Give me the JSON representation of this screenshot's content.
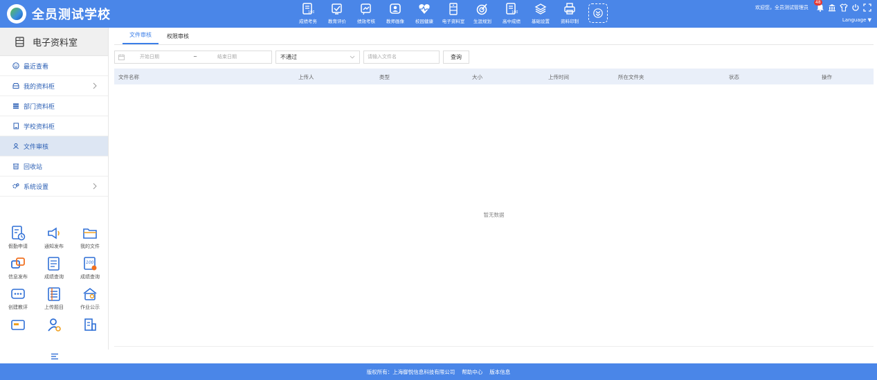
{
  "header": {
    "school_name": "全员测试学校",
    "modules": [
      {
        "label": "成绩考务",
        "icon": "exam-icon"
      },
      {
        "label": "教育评价",
        "icon": "evaluation-icon"
      },
      {
        "label": "绩效考核",
        "icon": "performance-icon"
      },
      {
        "label": "教师画像",
        "icon": "teacher-portrait-icon"
      },
      {
        "label": "校园健康",
        "icon": "health-icon"
      },
      {
        "label": "电子资料室",
        "icon": "archive-icon"
      },
      {
        "label": "生涯规划",
        "icon": "career-icon"
      },
      {
        "label": "高中成绩",
        "icon": "highschool-score-icon"
      },
      {
        "label": "基础设置",
        "icon": "settings-layers-icon"
      },
      {
        "label": "资料印制",
        "icon": "print-icon"
      }
    ],
    "welcome": "欢迎您，全员测试管理员",
    "notification_count": "48",
    "language": "Language ▼"
  },
  "sidebar": {
    "title": "电子资料室",
    "items": [
      {
        "label": "最近查看",
        "icon": "clock-smile-icon",
        "has_arrow": false,
        "active": false
      },
      {
        "label": "我的资料柜",
        "icon": "cabinet-icon",
        "has_arrow": true,
        "active": false
      },
      {
        "label": "部门资料柜",
        "icon": "department-icon",
        "has_arrow": false,
        "active": false
      },
      {
        "label": "学校资料柜",
        "icon": "school-file-icon",
        "has_arrow": false,
        "active": false
      },
      {
        "label": "文件审核",
        "icon": "audit-icon",
        "has_arrow": false,
        "active": true
      },
      {
        "label": "回收站",
        "icon": "trash-icon",
        "has_arrow": false,
        "active": false
      },
      {
        "label": "系统设置",
        "icon": "gear-icon",
        "has_arrow": true,
        "active": false
      }
    ],
    "quick_items": [
      {
        "label": "假勤申请",
        "icon": "leave-icon"
      },
      {
        "label": "通知发布",
        "icon": "megaphone-icon"
      },
      {
        "label": "我的文件",
        "icon": "folder-icon"
      },
      {
        "label": "信息发布",
        "icon": "info-publish-icon"
      },
      {
        "label": "成绩查询",
        "icon": "score-query-icon"
      },
      {
        "label": "成绩查询",
        "icon": "score-100-icon"
      },
      {
        "label": "创建教评",
        "icon": "chat-icon"
      },
      {
        "label": "上传题目",
        "icon": "upload-question-icon"
      },
      {
        "label": "作业公示",
        "icon": "homework-icon"
      },
      {
        "label": "",
        "icon": "card-icon"
      },
      {
        "label": "",
        "icon": "user-gear-icon"
      },
      {
        "label": "",
        "icon": "building-icon"
      }
    ]
  },
  "main": {
    "tabs": [
      {
        "label": "文件审核",
        "active": true
      },
      {
        "label": "权限审核",
        "active": false
      }
    ],
    "filters": {
      "start_date_placeholder": "开始日期",
      "date_separator": "~",
      "end_date_placeholder": "结束日期",
      "status_value": "不通过",
      "filename_placeholder": "请输入文件名",
      "query_label": "查询"
    },
    "columns": [
      "文件名称",
      "上传人",
      "类型",
      "大小",
      "上传时间",
      "所在文件夹",
      "状态",
      "操作"
    ],
    "empty_text": "暂无数据"
  },
  "footer": {
    "copyright": "版权所有：上海御悦信息科技有限公司",
    "help": "帮助中心",
    "version": "版本信息"
  }
}
